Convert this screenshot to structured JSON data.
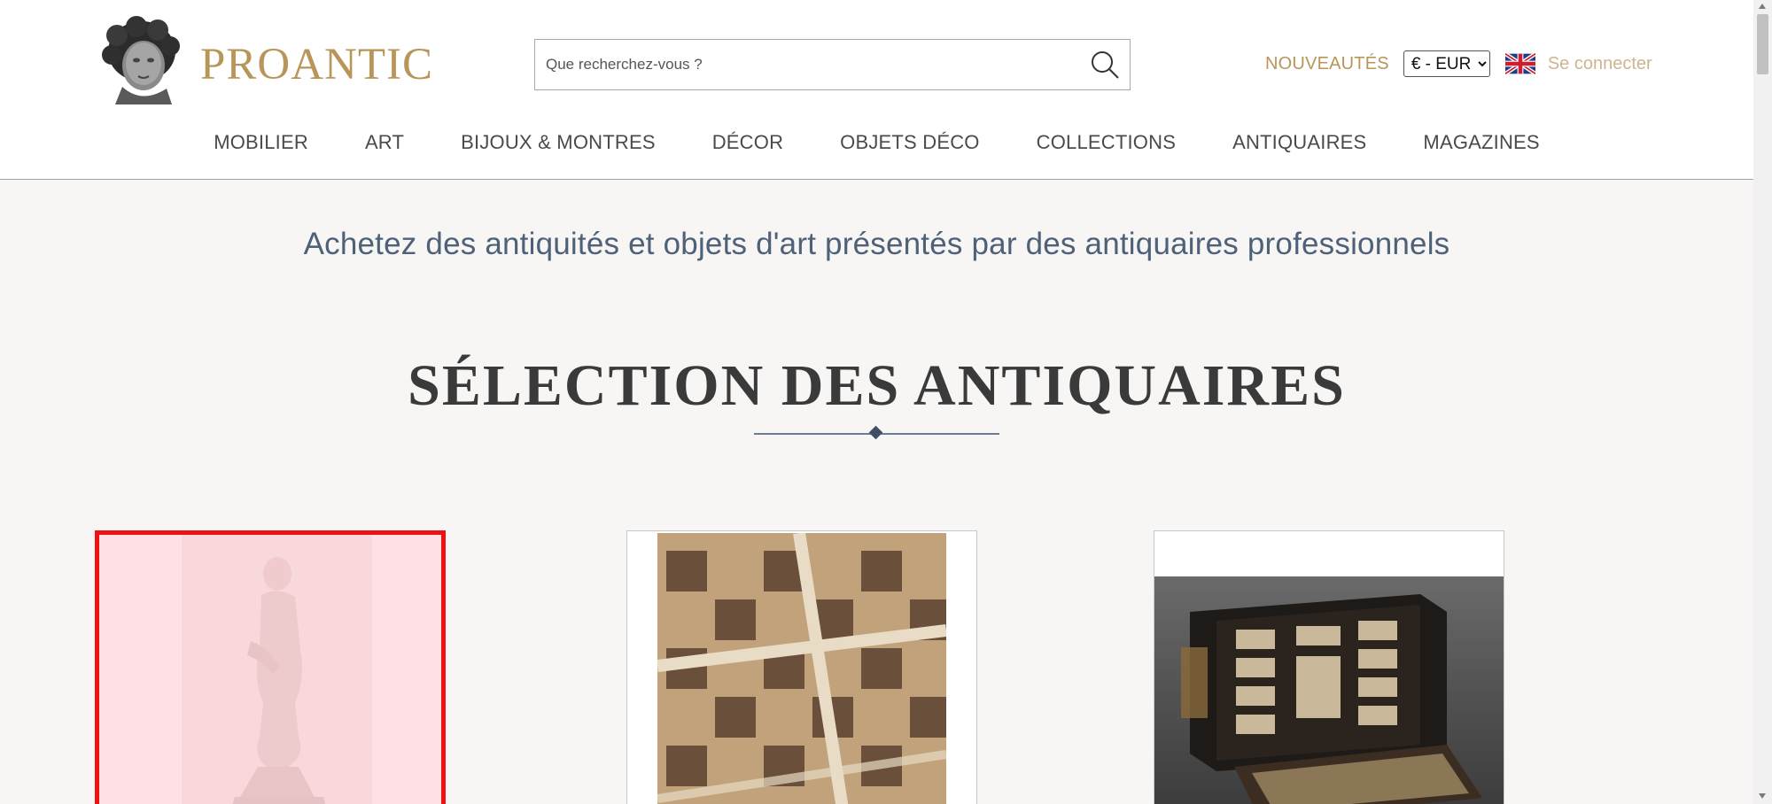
{
  "header": {
    "brand": "PROANTIC",
    "search": {
      "placeholder": "Que recherchez-vous ?",
      "value": ""
    },
    "new_link": "NOUVEAUTÉS",
    "currency": {
      "selected": "€ - EUR"
    },
    "language_flag": "uk-flag-icon",
    "login": "Se connecter"
  },
  "nav": {
    "items": [
      {
        "label": "MOBILIER"
      },
      {
        "label": "ART"
      },
      {
        "label": "BIJOUX & MONTRES"
      },
      {
        "label": "DÉCOR"
      },
      {
        "label": "OBJETS DÉCO"
      },
      {
        "label": "COLLECTIONS"
      },
      {
        "label": "ANTIQUAIRES"
      },
      {
        "label": "MAGAZINES"
      }
    ]
  },
  "main": {
    "tagline": "Achetez des antiquités et objets d'art présentés par des antiquaires professionnels",
    "section_title": "SÉLECTION DES ANTIQUAIRES"
  },
  "colors": {
    "brand_gold": "#b8965a",
    "tagline_blue": "#4e6178",
    "highlight_red": "#ee1111"
  }
}
